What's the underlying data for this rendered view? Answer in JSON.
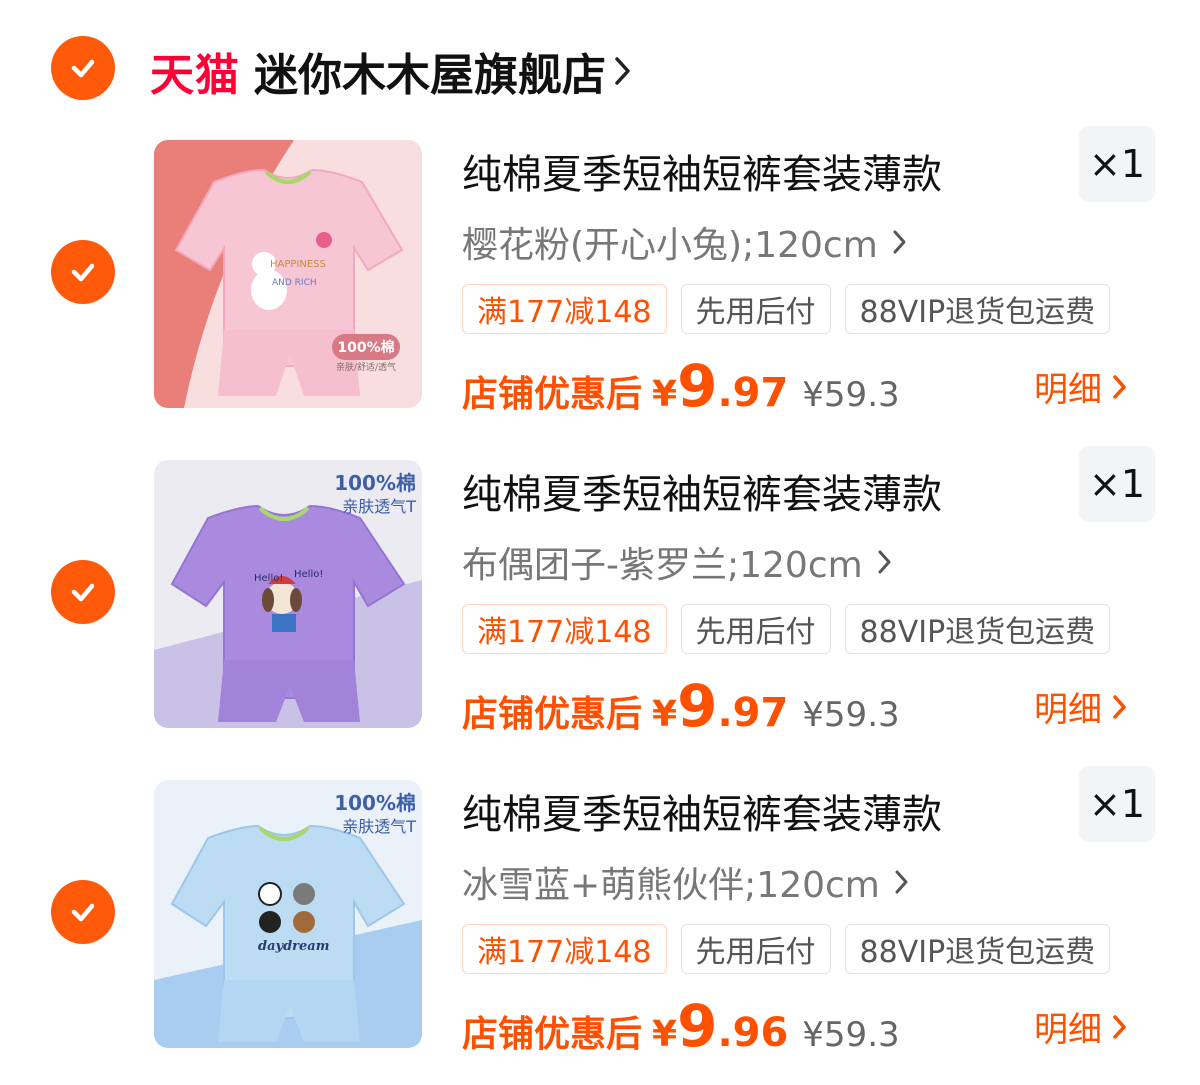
{
  "store": {
    "brand": "天猫",
    "name": "迷你木木屋旗舰店",
    "checked": true
  },
  "accent_color": "#ff5000",
  "items": [
    {
      "checked": true,
      "title": "纯棉夏季短袖短裤套装薄款",
      "quantity": "×1",
      "spec": "樱花粉(开心小兔);120cm",
      "tags": [
        "满177减148",
        "先用后付",
        "88VIP退货包运费"
      ],
      "price_label": "店铺优惠后",
      "currency": "¥",
      "price_int": "9",
      "price_dec": ".97",
      "original_price": "¥59.3",
      "detail_label": "明细",
      "image": {
        "print_lines": [
          "HAPPINESS",
          "AND RICH"
        ],
        "badge": "100%棉",
        "badge_sub": "亲肤/舒适/透气"
      }
    },
    {
      "checked": true,
      "title": "纯棉夏季短袖短裤套装薄款",
      "quantity": "×1",
      "spec": "布偶团子-紫罗兰;120cm",
      "tags": [
        "满177减148",
        "先用后付",
        "88VIP退货包运费"
      ],
      "price_label": "店铺优惠后",
      "currency": "¥",
      "price_int": "9",
      "price_dec": ".97",
      "original_price": "¥59.3",
      "detail_label": "明细",
      "image": {
        "badge": "100%棉",
        "badge_sub": "亲肤透气T",
        "print_lines": [
          "Hello!",
          "Hello!"
        ]
      }
    },
    {
      "checked": true,
      "title": "纯棉夏季短袖短裤套装薄款",
      "quantity": "×1",
      "spec": "冰雪蓝+萌熊伙伴;120cm",
      "tags": [
        "满177减148",
        "先用后付",
        "88VIP退货包运费"
      ],
      "price_label": "店铺优惠后",
      "currency": "¥",
      "price_int": "9",
      "price_dec": ".96",
      "original_price": "¥59.3",
      "detail_label": "明细",
      "image": {
        "badge": "100%棉",
        "badge_sub": "亲肤透气T",
        "print_lines": [
          "daydream"
        ]
      }
    }
  ]
}
